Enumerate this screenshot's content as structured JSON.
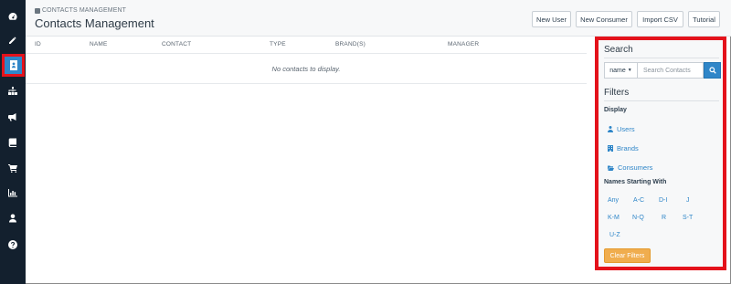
{
  "sidebar": {
    "items": [
      {
        "icon": "dashboard-icon"
      },
      {
        "icon": "pencil-icon"
      },
      {
        "icon": "contact-book-icon",
        "active": true
      },
      {
        "icon": "sitemap-icon"
      },
      {
        "icon": "megaphone-icon"
      },
      {
        "icon": "book-icon"
      },
      {
        "icon": "cart-icon"
      },
      {
        "icon": "bar-chart-icon"
      },
      {
        "icon": "user-icon"
      },
      {
        "icon": "help-icon"
      }
    ]
  },
  "header": {
    "breadcrumb": "CONTACTS MANAGEMENT",
    "title": "Contacts Management",
    "buttons": {
      "new_user": "New User",
      "new_consumer": "New Consumer",
      "import_csv": "Import CSV",
      "tutorial": "Tutorial"
    }
  },
  "table": {
    "columns": [
      "ID",
      "NAME",
      "CONTACT",
      "TYPE",
      "BRAND(S)",
      "MANAGER"
    ],
    "empty_message": "No contacts to display."
  },
  "panel": {
    "search_heading": "Search",
    "search_field_selected": "name",
    "search_placeholder": "Search Contacts",
    "filters_heading": "Filters",
    "display_heading": "Display",
    "display_items": [
      "Users",
      "Brands",
      "Consumers"
    ],
    "names_heading": "Names Starting With",
    "letters": [
      "Any",
      "A-C",
      "D-I",
      "J",
      "K-M",
      "N-Q",
      "R",
      "S-T",
      "U-Z"
    ],
    "clear_filters": "Clear Filters"
  },
  "colors": {
    "sidebar_bg": "#13202e",
    "accent_blue": "#2f86c8",
    "highlight_red": "#e4121b",
    "clear_button": "#f0ad4e"
  }
}
